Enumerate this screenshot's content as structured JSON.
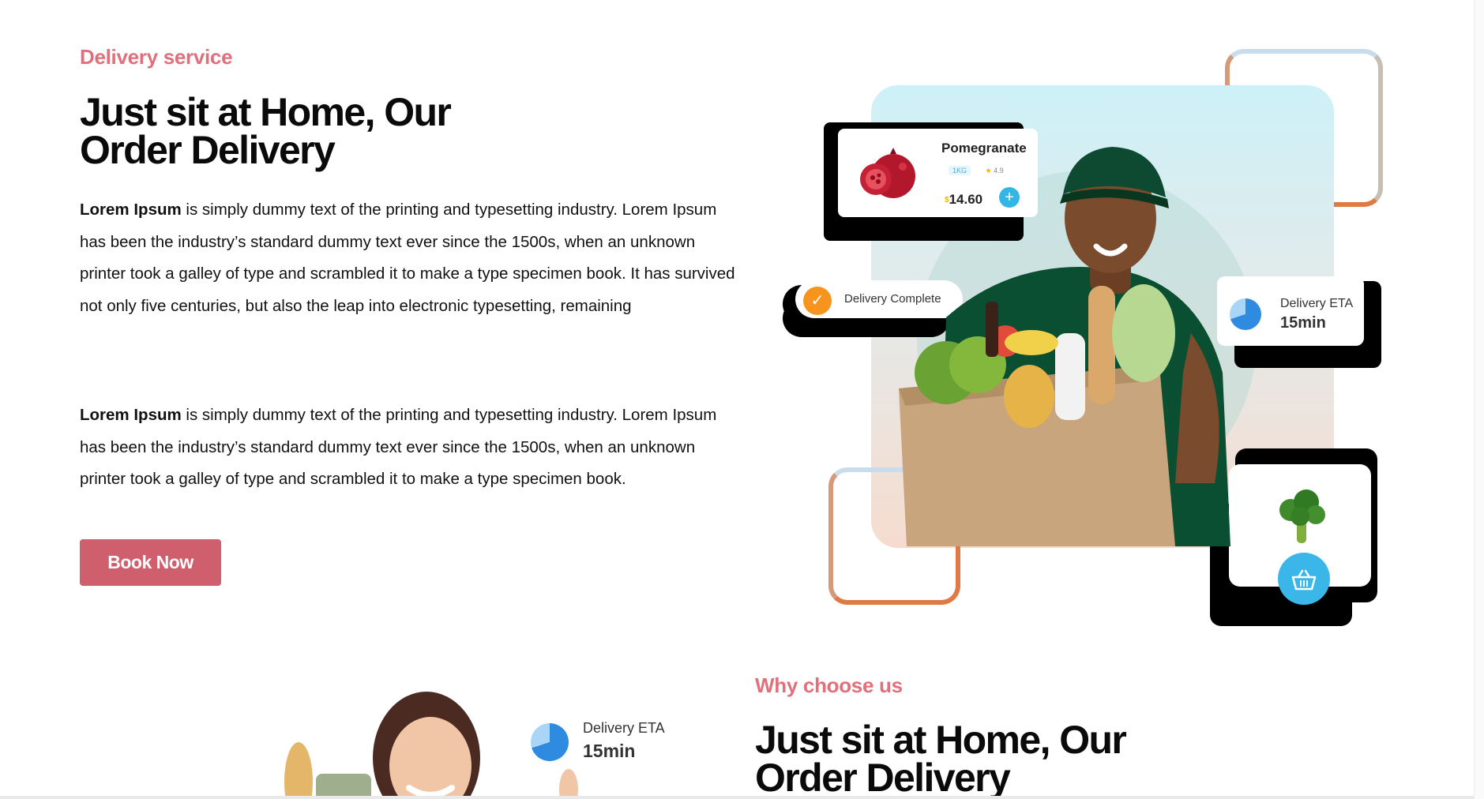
{
  "section1": {
    "eyebrow": "Delivery service",
    "heading_line1": "Just sit at Home, Our",
    "heading_line2": "Order Delivery",
    "para1_bold": "Lorem Ipsum",
    "para1_rest": " is simply dummy text of the printing and typesetting industry. Lorem Ipsum has been the industry’s standard dummy text ever since the 1500s, when an unknown printer took a galley of type and scrambled it to make a type specimen book. It has survived not only five centuries, but also the leap into electronic typesetting, remaining",
    "para2_bold": "Lorem Ipsum",
    "para2_rest": " is simply dummy text of the printing and typesetting industry. Lorem Ipsum has been the industry’s standard dummy text ever since the 1500s, when an unknown printer took a galley of type and scrambled it to make a type specimen book.",
    "button_label": "Book Now"
  },
  "hero": {
    "product_card": {
      "name": "Pomegranate",
      "weight": "1KG",
      "rating": "4.9",
      "price": "14.60",
      "currency": "$",
      "add_icon": "plus-icon"
    },
    "status_card": {
      "label": "Delivery Complete",
      "icon": "check-icon"
    },
    "eta_card": {
      "label": "Delivery ETA",
      "value": "15min",
      "icon": "timer-ring-icon"
    },
    "basket_icon": "basket-icon"
  },
  "section2": {
    "eyebrow": "Why choose us",
    "heading_line1": "Just sit at Home, Our",
    "heading_line2": "Order Delivery",
    "eta_label": "Delivery ETA",
    "eta_value": "15min"
  },
  "colors": {
    "accent": "#e0707c",
    "button": "#cf5f6c",
    "frame_orange": "#e07a45",
    "blue": "#33b6e6"
  }
}
